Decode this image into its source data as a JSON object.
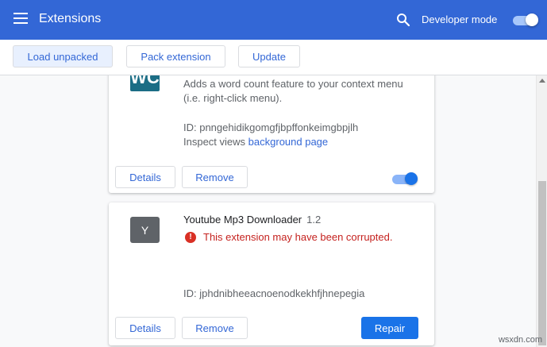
{
  "header": {
    "title": "Extensions",
    "developer_mode_label": "Developer mode",
    "developer_mode_on": true,
    "accent": "#3367d6"
  },
  "toolbar": {
    "load_unpacked": "Load unpacked",
    "pack_extension": "Pack extension",
    "update": "Update"
  },
  "extensions": [
    {
      "icon_text": "WC",
      "description_line1": "Adds a word count feature to your context menu",
      "description_line2": "(i.e. right-click menu).",
      "id": "ID: pnngehidikgomgfjbpffonkeimgbpjlh",
      "inspect_label": "Inspect views",
      "inspect_link": "background page",
      "details_label": "Details",
      "remove_label": "Remove",
      "enabled": true
    },
    {
      "icon_text": "Y",
      "name": "Youtube Mp3 Downloader",
      "version": "1.2",
      "error": "This extension may have been corrupted.",
      "id": "ID: jphdnibheeacnoenodkekhfjhnepegia",
      "details_label": "Details",
      "remove_label": "Remove",
      "repair_label": "Repair"
    }
  ],
  "watermark": "wsxdn.com"
}
